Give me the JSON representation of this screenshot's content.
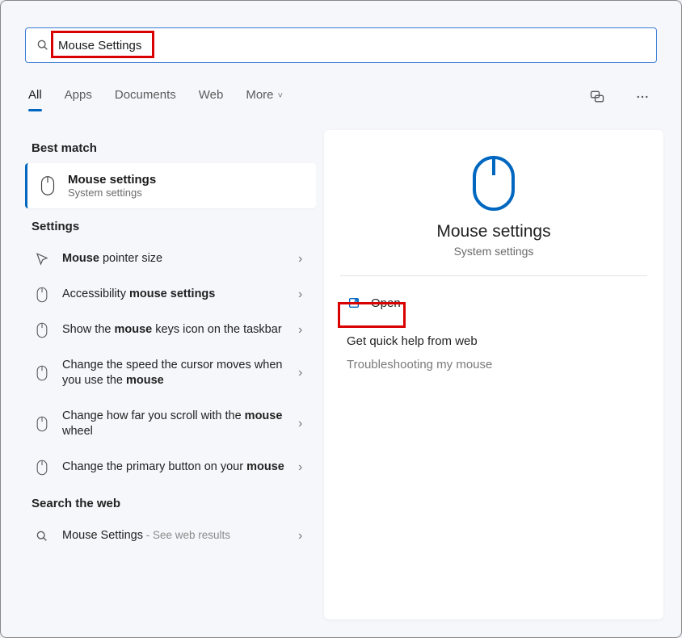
{
  "search": {
    "value": "Mouse Settings"
  },
  "tabs": {
    "all": "All",
    "apps": "Apps",
    "documents": "Documents",
    "web": "Web",
    "more": "More"
  },
  "sections": {
    "best_match": "Best match",
    "settings": "Settings",
    "search_web": "Search the web"
  },
  "best_match": {
    "title": "Mouse settings",
    "subtitle": "System settings"
  },
  "settings_items": [
    {
      "prefix": "",
      "bold1": "Mouse",
      "mid": " pointer size",
      "bold2": "",
      "suffix": ""
    },
    {
      "prefix": "Accessibility ",
      "bold1": "mouse settings",
      "mid": "",
      "bold2": "",
      "suffix": ""
    },
    {
      "prefix": "Show the ",
      "bold1": "mouse",
      "mid": " keys icon on the taskbar",
      "bold2": "",
      "suffix": ""
    },
    {
      "prefix": "Change the speed the cursor moves when you use the ",
      "bold1": "mouse",
      "mid": "",
      "bold2": "",
      "suffix": ""
    },
    {
      "prefix": "Change how far you scroll with the ",
      "bold1": "mouse",
      "mid": " wheel",
      "bold2": "",
      "suffix": ""
    },
    {
      "prefix": "Change the primary button on your ",
      "bold1": "mouse",
      "mid": "",
      "bold2": "",
      "suffix": ""
    }
  ],
  "web_item": {
    "label": "Mouse Settings",
    "hint": " - See web results"
  },
  "detail": {
    "title": "Mouse settings",
    "subtitle": "System settings",
    "open": "Open",
    "help": "Get quick help from web",
    "troubleshoot": "Troubleshooting my mouse"
  }
}
